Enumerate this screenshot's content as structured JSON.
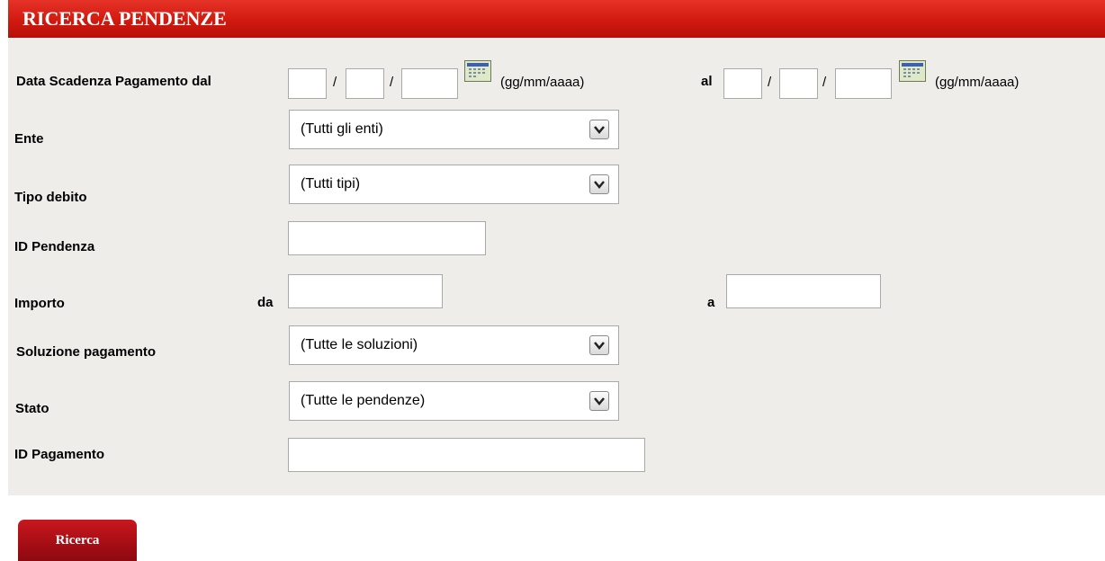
{
  "header": {
    "title": "RICERCA PENDENZE"
  },
  "form": {
    "data_scadenza": {
      "label": "Data Scadenza Pagamento dal",
      "separator": "/",
      "format_hint": "(gg/mm/aaaa)",
      "al_label": "al"
    },
    "ente": {
      "label": "Ente",
      "value": "(Tutti gli enti)"
    },
    "tipo_debito": {
      "label": "Tipo debito",
      "value": "(Tutti tipi)"
    },
    "id_pendenza": {
      "label": "ID Pendenza",
      "value": ""
    },
    "importo": {
      "label": "Importo",
      "da_label": "da",
      "a_label": "a",
      "da_value": "",
      "a_value": ""
    },
    "soluzione_pagamento": {
      "label": "Soluzione pagamento",
      "value": "(Tutte le soluzioni)"
    },
    "stato": {
      "label": "Stato",
      "value": "(Tutte le pendenze)"
    },
    "id_pagamento": {
      "label": "ID Pagamento",
      "value": ""
    }
  },
  "actions": {
    "search_label": "Ricerca"
  },
  "icons": {
    "calendar": "calendar-icon",
    "dropdown": "chevron-down-icon"
  },
  "colors": {
    "header": "#d11a10",
    "panel": "#efedea",
    "button": "#a50d14"
  }
}
